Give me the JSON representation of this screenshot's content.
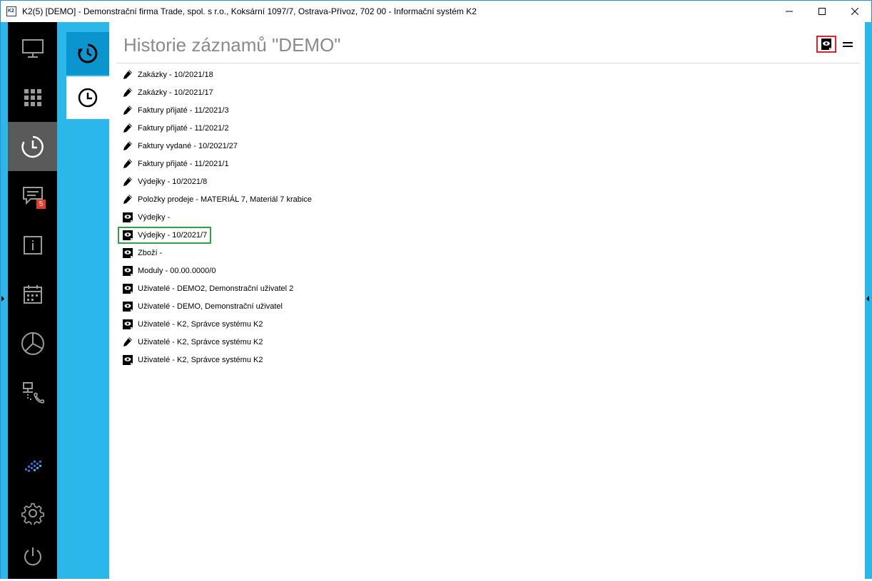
{
  "window": {
    "title": "K2(5) [DEMO] - Demonstrační firma Trade, spol. s r.o., Koksární 1097/7, Ostrava-Přívoz, 702 00 - Informační systém K2",
    "app_icon_text": "K2",
    "controls": [
      "minimize-icon",
      "maximize-icon",
      "close-icon"
    ]
  },
  "sidebar": {
    "items": [
      {
        "name": "desktop",
        "icon": "monitor-icon"
      },
      {
        "name": "apps",
        "icon": "grid-icon"
      },
      {
        "name": "history",
        "icon": "history-icon",
        "active": true
      },
      {
        "name": "messages",
        "icon": "chat-icon",
        "badge": "5"
      },
      {
        "name": "info",
        "icon": "info-icon"
      },
      {
        "name": "calendar",
        "icon": "calendar-icon"
      },
      {
        "name": "reports",
        "icon": "pie-chart-icon"
      },
      {
        "name": "network",
        "icon": "network-phone-icon"
      },
      {
        "name": "k2-logo",
        "icon": "k2-logo-icon"
      },
      {
        "name": "settings",
        "icon": "gear-icon"
      },
      {
        "name": "power",
        "icon": "power-icon"
      }
    ]
  },
  "panel_tabs": [
    {
      "name": "history",
      "icon": "history-icon",
      "active": false
    },
    {
      "name": "recent",
      "icon": "clock-icon",
      "active": true
    }
  ],
  "main": {
    "title": "Historie záznamů \"DEMO\"",
    "items": [
      {
        "type": "edit",
        "label": "Zakázky - 10/2021/18"
      },
      {
        "type": "edit",
        "label": "Zakázky - 10/2021/17"
      },
      {
        "type": "edit",
        "label": "Faktury přijaté - 11/2021/3"
      },
      {
        "type": "edit",
        "label": "Faktury přijaté - 11/2021/2"
      },
      {
        "type": "edit",
        "label": "Faktury vydané - 10/2021/27"
      },
      {
        "type": "edit",
        "label": "Faktury přijaté - 11/2021/1"
      },
      {
        "type": "edit",
        "label": "Výdejky - 10/2021/8"
      },
      {
        "type": "edit",
        "label": "Položky prodeje - MATERIÁL 7, Materiál 7 krabice"
      },
      {
        "type": "view",
        "label": "Výdejky -"
      },
      {
        "type": "view",
        "label": "Výdejky - 10/2021/7",
        "selected": true
      },
      {
        "type": "view",
        "label": "Zboží -"
      },
      {
        "type": "view",
        "label": "Moduly - 00.00.0000/0"
      },
      {
        "type": "view",
        "label": "Uživatelé - DEMO2, Demonstrační uživatel 2"
      },
      {
        "type": "view",
        "label": "Uživatelé - DEMO, Demonstrační uživatel"
      },
      {
        "type": "view",
        "label": "Uživatelé - K2, Správce systému K2"
      },
      {
        "type": "edit",
        "label": "Uživatelé - K2, Správce systému K2"
      },
      {
        "type": "view",
        "label": "Uživatelé - K2, Správce systému K2"
      }
    ]
  },
  "colors": {
    "accent_blue": "#2bb7ea",
    "dark_blue_tab": "#0b95cf",
    "sidebar_bg": "#000000",
    "sidebar_active": "#5a5a5a",
    "badge": "#e83a2a",
    "selection_border": "#2ea24a",
    "highlight_border": "#e0202a"
  }
}
